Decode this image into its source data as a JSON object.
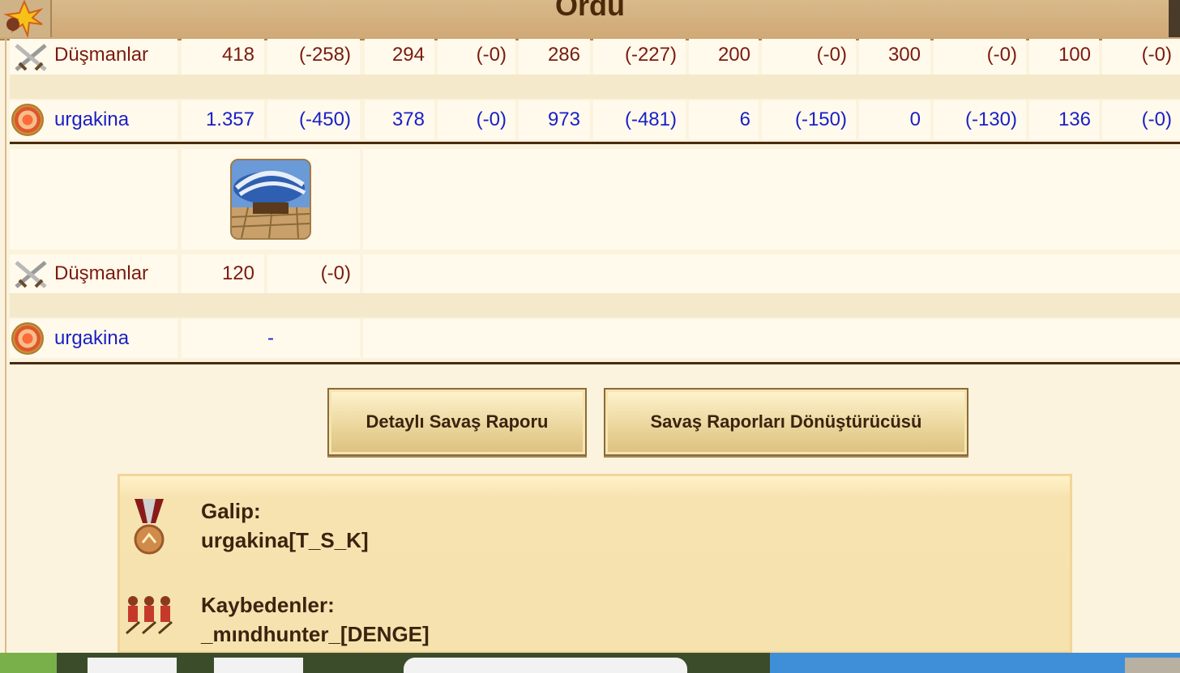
{
  "window": {
    "title": "Ordu"
  },
  "table1": {
    "rows": [
      {
        "name": "Düşmanlar",
        "icon": "crossed-swords-icon",
        "color": "#7b1a10",
        "values": [
          "418",
          "(-258)",
          "294",
          "(-0)",
          "286",
          "(-227)",
          "200",
          "(-0)",
          "300",
          "(-0)",
          "100",
          "(-0)"
        ]
      },
      {
        "name": "urgakina",
        "icon": "shield-icon",
        "color": "#1a1fc6",
        "values": [
          "1.357",
          "(-450)",
          "378",
          "(-0)",
          "973",
          "(-481)",
          "6",
          "(-150)",
          "0",
          "(-130)",
          "136",
          "(-0)"
        ]
      }
    ]
  },
  "table2": {
    "unit_icon": "airship-unit-icon",
    "rows": [
      {
        "name": "Düşmanlar",
        "icon": "crossed-swords-icon",
        "values": [
          "120",
          "(-0)"
        ]
      },
      {
        "name": "urgakina",
        "icon": "shield-icon",
        "values": [
          "-"
        ]
      }
    ]
  },
  "buttons": {
    "detailed_report": "Detaylı Savaş Raporu",
    "report_converter": "Savaş Raporları Dönüştürücüsü"
  },
  "result": {
    "winner_label": "Galip:",
    "winner_name": "urgakina[T_S_K]",
    "winner_icon": "medal-icon",
    "losers_label": "Kaybedenler:",
    "losers_name": "_mındhunter_[DENGE]",
    "losers_icon": "soldiers-icon"
  }
}
